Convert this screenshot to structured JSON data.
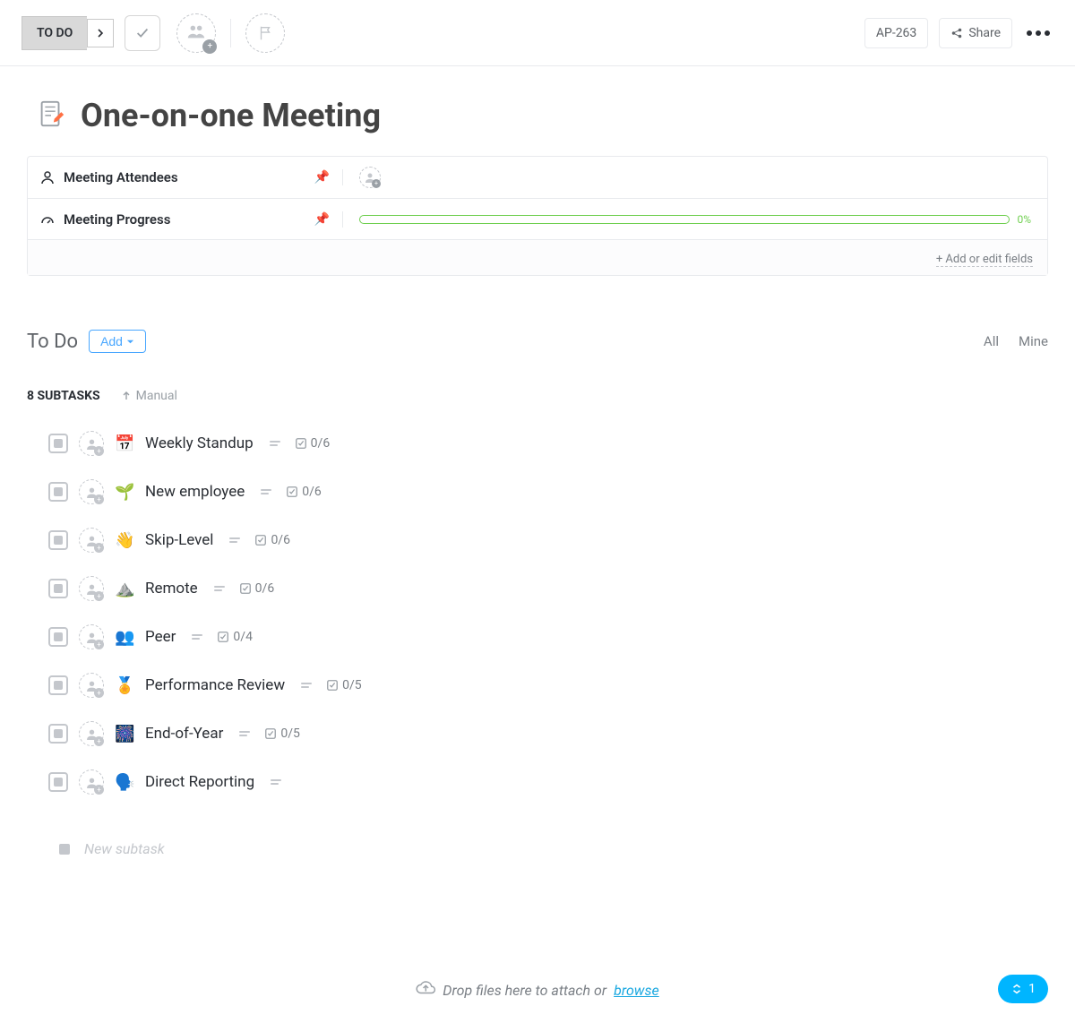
{
  "toolbar": {
    "status": "TO DO",
    "ticket_id": "AP-263",
    "share_label": "Share"
  },
  "title": "One-on-one Meeting",
  "fields": {
    "attendees_label": "Meeting Attendees",
    "progress_label": "Meeting Progress",
    "progress_value": "0%",
    "add_link": "+ Add or edit fields"
  },
  "section": {
    "heading": "To Do",
    "add_label": "Add",
    "filter_all": "All",
    "filter_mine": "Mine"
  },
  "subtasks": {
    "count": "8 SUBTASKS",
    "sort": "Manual",
    "items": [
      {
        "emoji": "📅",
        "name": "Weekly Standup",
        "checks": "0/6"
      },
      {
        "emoji": "🌱",
        "name": "New employee",
        "checks": "0/6"
      },
      {
        "emoji": "👋",
        "name": "Skip-Level",
        "checks": "0/6"
      },
      {
        "emoji": "⛰️",
        "name": "Remote",
        "checks": "0/6"
      },
      {
        "emoji": "👥",
        "name": "Peer",
        "checks": "0/4"
      },
      {
        "emoji": "🏅",
        "name": "Performance Review",
        "checks": "0/5"
      },
      {
        "emoji": "🎆",
        "name": "End-of-Year",
        "checks": "0/5"
      },
      {
        "emoji": "🗣️",
        "name": "Direct Reporting",
        "checks": ""
      }
    ],
    "new_placeholder": "New subtask"
  },
  "footer": {
    "drop_text": "Drop files here to attach or ",
    "browse": "browse",
    "pill_count": "1"
  }
}
